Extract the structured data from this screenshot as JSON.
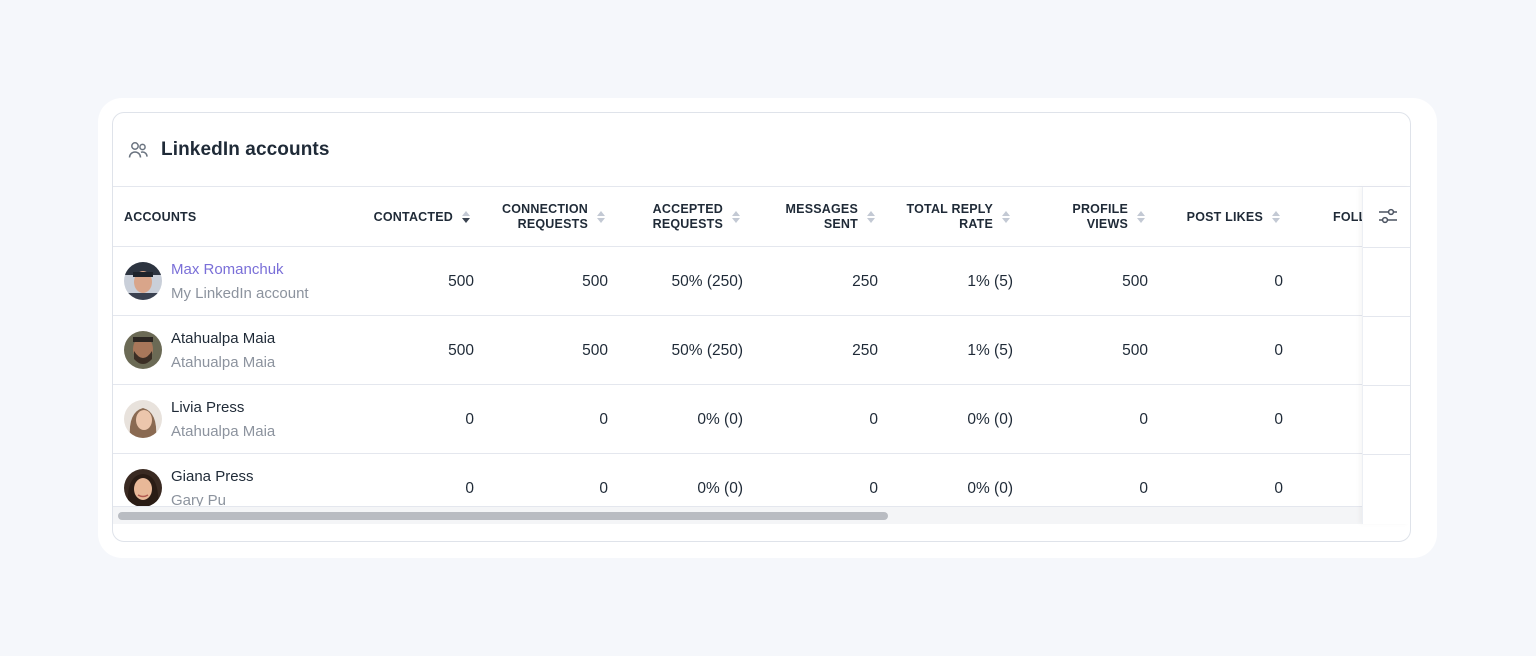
{
  "panel": {
    "title": "LinkedIn accounts",
    "icon": "users-icon"
  },
  "columns": [
    {
      "label": "ACCOUNTS",
      "sortable": false
    },
    {
      "label": "CONTACTED",
      "sortable": true,
      "sorted": "desc"
    },
    {
      "label": "CONNECTION REQUESTS",
      "sortable": true
    },
    {
      "label": "ACCEPTED REQUESTS",
      "sortable": true
    },
    {
      "label": "MESSAGES SENT",
      "sortable": true
    },
    {
      "label": "TOTAL REPLY RATE",
      "sortable": true
    },
    {
      "label": "PROFILE VIEWS",
      "sortable": true
    },
    {
      "label": "POST LIKES",
      "sortable": true
    },
    {
      "label": "FOLL",
      "sortable": false
    }
  ],
  "header_lines": {
    "accounts": [
      "ACCOUNTS"
    ],
    "contacted": [
      "CONTACTED"
    ],
    "connection": [
      "CONNECTION",
      "REQUESTS"
    ],
    "accepted": [
      "ACCEPTED",
      "REQUESTS"
    ],
    "messages": [
      "MESSAGES",
      "SENT"
    ],
    "reply": [
      "TOTAL REPLY",
      "RATE"
    ],
    "views": [
      "PROFILE",
      "VIEWS"
    ],
    "likes": [
      "POST LIKES"
    ],
    "foll": [
      "FOLL"
    ]
  },
  "rows": [
    {
      "name": "Max Romanchuk",
      "subtitle": "My LinkedIn account",
      "is_link": true,
      "contacted": "500",
      "connection_requests": "500",
      "accepted_requests": "50% (250)",
      "messages_sent": "250",
      "total_reply_rate": "1% (5)",
      "profile_views": "500",
      "post_likes": "0"
    },
    {
      "name": "Atahualpa Maia",
      "subtitle": "Atahualpa Maia",
      "is_link": false,
      "contacted": "500",
      "connection_requests": "500",
      "accepted_requests": "50% (250)",
      "messages_sent": "250",
      "total_reply_rate": "1% (5)",
      "profile_views": "500",
      "post_likes": "0"
    },
    {
      "name": "Livia Press",
      "subtitle": "Atahualpa Maia",
      "is_link": false,
      "contacted": "0",
      "connection_requests": "0",
      "accepted_requests": "0% (0)",
      "messages_sent": "0",
      "total_reply_rate": "0% (0)",
      "profile_views": "0",
      "post_likes": "0"
    },
    {
      "name": "Giana Press",
      "subtitle": "Gary Pu",
      "is_link": false,
      "contacted": "0",
      "connection_requests": "0",
      "accepted_requests": "0% (0)",
      "messages_sent": "0",
      "total_reply_rate": "0% (0)",
      "profile_views": "0",
      "post_likes": "0"
    }
  ],
  "colors": {
    "background": "#f5f7fb",
    "link": "#7a6fd8",
    "text": "#1f2a37",
    "muted": "#8c939e",
    "border": "#e4e7ee"
  }
}
